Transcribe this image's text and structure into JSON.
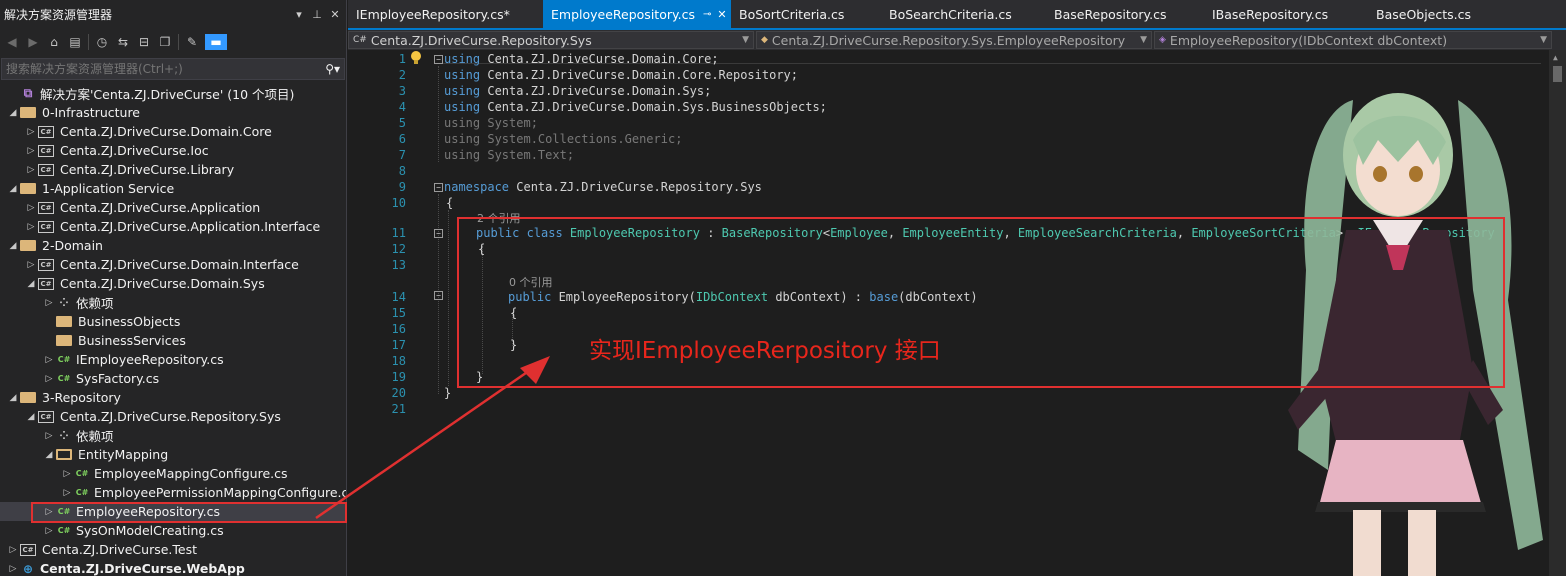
{
  "solution_explorer": {
    "title": "解决方案资源管理器",
    "search_placeholder": "搜索解决方案资源管理器(Ctrl+;)",
    "tree": [
      {
        "label": "解决方案'Centa.ZJ.DriveCurse' (10 个项目)",
        "icon": "solution-icon",
        "depth": 0,
        "expander": "none"
      },
      {
        "label": "0-Infrastructure",
        "icon": "folder-icon",
        "depth": 0,
        "expander": "expanded"
      },
      {
        "label": "Centa.ZJ.DriveCurse.Domain.Core",
        "icon": "csharp-project-icon",
        "depth": 1,
        "expander": "collapsed"
      },
      {
        "label": "Centa.ZJ.DriveCurse.Ioc",
        "icon": "csharp-project-icon",
        "depth": 1,
        "expander": "collapsed"
      },
      {
        "label": "Centa.ZJ.DriveCurse.Library",
        "icon": "csharp-project-icon",
        "depth": 1,
        "expander": "collapsed"
      },
      {
        "label": "1-Application Service",
        "icon": "folder-icon",
        "depth": 0,
        "expander": "expanded"
      },
      {
        "label": "Centa.ZJ.DriveCurse.Application",
        "icon": "csharp-project-icon",
        "depth": 1,
        "expander": "collapsed"
      },
      {
        "label": "Centa.ZJ.DriveCurse.Application.Interface",
        "icon": "csharp-project-icon",
        "depth": 1,
        "expander": "collapsed"
      },
      {
        "label": "2-Domain",
        "icon": "folder-icon",
        "depth": 0,
        "expander": "expanded"
      },
      {
        "label": "Centa.ZJ.DriveCurse.Domain.Interface",
        "icon": "csharp-project-icon",
        "depth": 1,
        "expander": "collapsed"
      },
      {
        "label": "Centa.ZJ.DriveCurse.Domain.Sys",
        "icon": "csharp-project-icon",
        "depth": 1,
        "expander": "expanded"
      },
      {
        "label": "依赖项",
        "icon": "dependencies-icon",
        "depth": 2,
        "expander": "collapsed"
      },
      {
        "label": "BusinessObjects",
        "icon": "folder-icon",
        "depth": 2,
        "expander": "none"
      },
      {
        "label": "BusinessServices",
        "icon": "folder-icon",
        "depth": 2,
        "expander": "none"
      },
      {
        "label": "IEmployeeRepository.cs",
        "icon": "csharp-file-icon",
        "depth": 2,
        "expander": "collapsed"
      },
      {
        "label": "SysFactory.cs",
        "icon": "csharp-file-icon",
        "depth": 2,
        "expander": "collapsed"
      },
      {
        "label": "3-Repository",
        "icon": "folder-icon",
        "depth": 0,
        "expander": "expanded"
      },
      {
        "label": "Centa.ZJ.DriveCurse.Repository.Sys",
        "icon": "csharp-project-icon",
        "depth": 1,
        "expander": "expanded"
      },
      {
        "label": "依赖项",
        "icon": "dependencies-icon",
        "depth": 2,
        "expander": "collapsed"
      },
      {
        "label": "EntityMapping",
        "icon": "folder-open-icon",
        "depth": 2,
        "expander": "expanded"
      },
      {
        "label": "EmployeeMappingConfigure.cs",
        "icon": "csharp-file-icon",
        "depth": 3,
        "expander": "collapsed"
      },
      {
        "label": "EmployeePermissionMappingConfigure.cs",
        "icon": "csharp-file-icon",
        "depth": 3,
        "expander": "collapsed"
      },
      {
        "label": "EmployeeRepository.cs",
        "icon": "csharp-file-icon",
        "depth": 2,
        "expander": "collapsed",
        "selected": true
      },
      {
        "label": "SysOnModelCreating.cs",
        "icon": "csharp-file-icon",
        "depth": 2,
        "expander": "collapsed"
      },
      {
        "label": "Centa.ZJ.DriveCurse.Test",
        "icon": "csharp-project-icon",
        "depth": 0,
        "expander": "collapsed"
      },
      {
        "label": "Centa.ZJ.DriveCurse.WebApp",
        "icon": "web-project-icon",
        "depth": 0,
        "expander": "collapsed",
        "bold": true
      }
    ]
  },
  "editor": {
    "tabs": [
      {
        "label": "IEmployeeRepository.cs*",
        "active": false
      },
      {
        "label": "EmployeeRepository.cs",
        "active": true
      },
      {
        "label": "BoSortCriteria.cs",
        "active": false
      },
      {
        "label": "BoSearchCriteria.cs",
        "active": false
      },
      {
        "label": "BaseRepository.cs",
        "active": false
      },
      {
        "label": "IBaseRepository.cs",
        "active": false
      },
      {
        "label": "BaseObjects.cs",
        "active": false
      }
    ],
    "nav": {
      "project": "Centa.ZJ.DriveCurse.Repository.Sys",
      "type": "Centa.ZJ.DriveCurse.Repository.Sys.EmployeeRepository",
      "member": "EmployeeRepository(IDbContext dbContext)"
    },
    "line_numbers": [
      "1",
      "2",
      "3",
      "4",
      "5",
      "6",
      "7",
      "8",
      "9",
      "10",
      "11",
      "12",
      "13",
      "14",
      "15",
      "16",
      "17",
      "18",
      "19",
      "20",
      "21"
    ],
    "code": {
      "l1": "using",
      "l1b": " Centa.ZJ.DriveCurse.Domain.Core;",
      "l2": "using",
      "l2b": " Centa.ZJ.DriveCurse.Domain.Core.Repository;",
      "l3": "using",
      "l3b": " Centa.ZJ.DriveCurse.Domain.Sys;",
      "l4": "using",
      "l4b": " Centa.ZJ.DriveCurse.Domain.Sys.BusinessObjects;",
      "l5": "using System;",
      "l6": "using System.Collections.Generic;",
      "l7": "using System.Text;",
      "l9a": "namespace",
      "l9b": " Centa.ZJ.DriveCurse.Repository.Sys",
      "l10": "{",
      "ref11": "2 个引用",
      "l11a": "public class",
      "l11b": " EmployeeRepository",
      "l11c": " : ",
      "l11d": "BaseRepository",
      "l11e": "<",
      "l11f": "Employee",
      "l11g": ", ",
      "l11h": "EmployeeEntity",
      "l11i": ", ",
      "l11j": "EmployeeSearchCriteria",
      "l11k": ", ",
      "l11l": "EmployeeSortCriteria",
      "l11m": ">, ",
      "l11n": "IEmployeeRepository",
      "l12": "{",
      "ref14": "0 个引用",
      "l14a": "public",
      "l14b": " EmployeeRepository(",
      "l14c": "IDbContext",
      "l14d": " dbContext) : ",
      "l14e": "base",
      "l14f": "(dbContext)",
      "l15": "{",
      "l17": "}",
      "l19": "}",
      "l20": "}"
    }
  },
  "annotation": {
    "text": "实现IEmployeeRerpository 接口",
    "color": "#e8261c"
  },
  "colors": {
    "accent": "#007acc",
    "highlight_border": "#e03030",
    "keyword": "#569cd6",
    "type": "#4ec9b0",
    "line_number": "#2b91af"
  }
}
